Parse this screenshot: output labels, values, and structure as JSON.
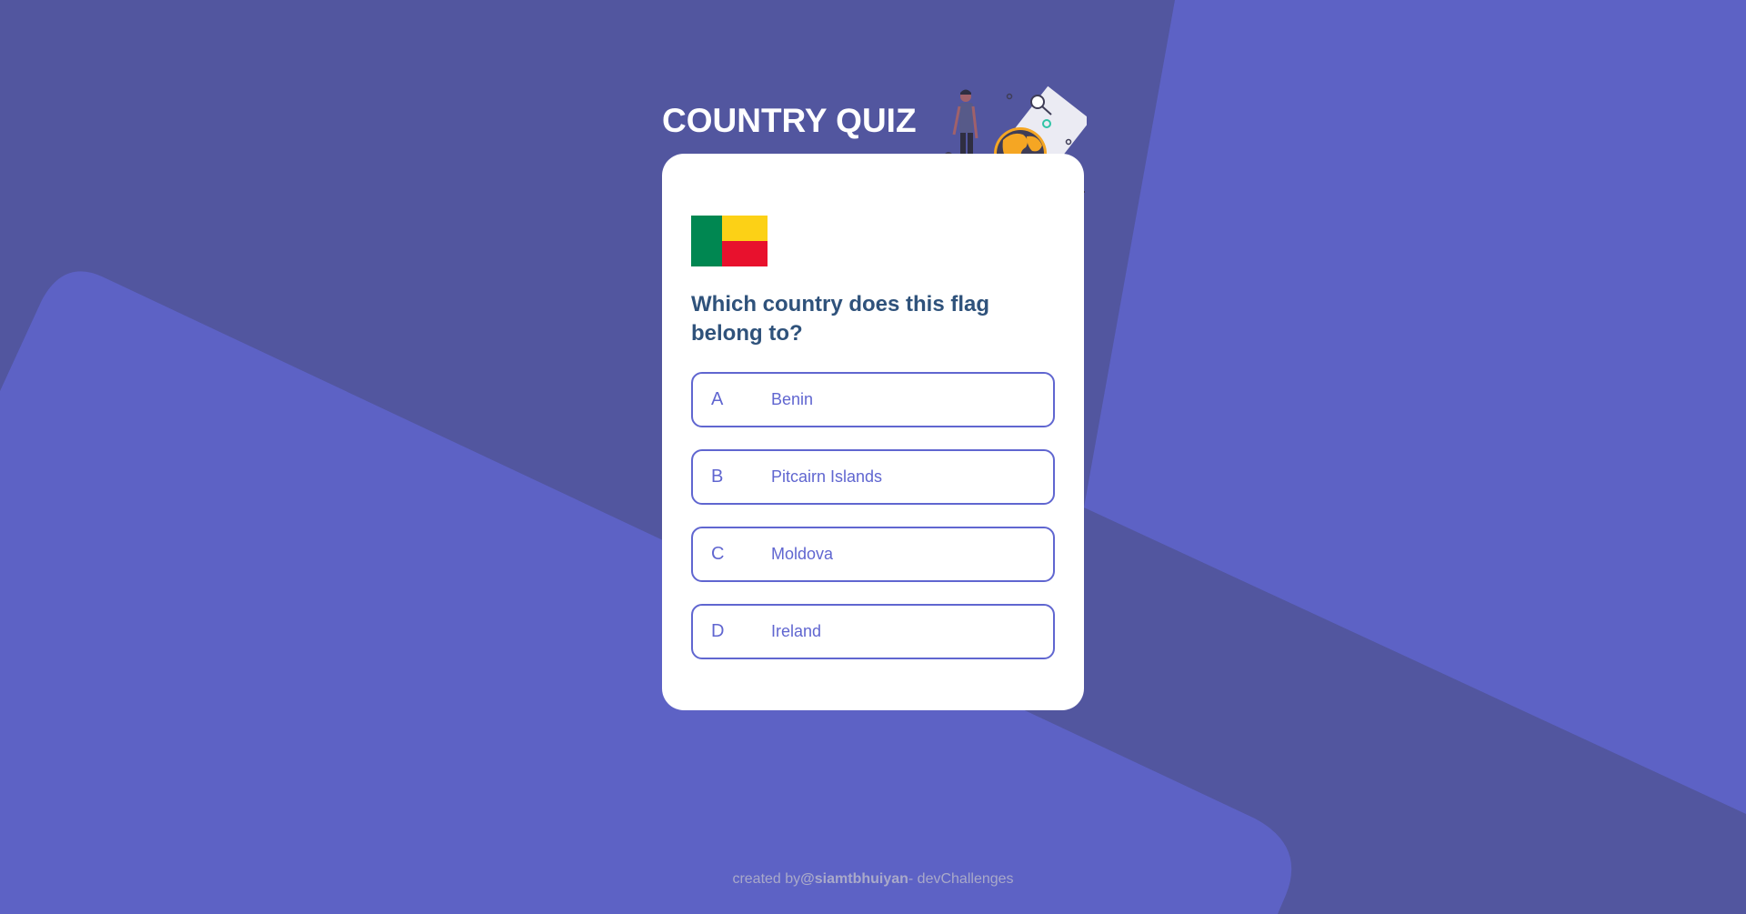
{
  "page": {
    "title": "COUNTRY QUIZ"
  },
  "colors": {
    "background": "#52569f",
    "background_shape": "#5d62c5",
    "card": "#ffffff",
    "question": "#2f527b",
    "option_accent": "#6066d0",
    "footer_text": "#a9a9c9"
  },
  "illustration": {
    "icon": "traveler-with-globe-icon"
  },
  "quiz": {
    "flag_icon": "benin-flag-icon",
    "flag_colors": [
      "#008751",
      "#fcd116",
      "#e8112d"
    ],
    "question": "Which country does this flag belong to?",
    "options": [
      {
        "letter": "A",
        "text": "Benin"
      },
      {
        "letter": "B",
        "text": "Pitcairn Islands"
      },
      {
        "letter": "C",
        "text": "Moldova"
      },
      {
        "letter": "D",
        "text": "Ireland"
      }
    ]
  },
  "footer": {
    "prefix": "created by",
    "handle": "@siamtbhuiyan",
    "suffix": "- devChallenges"
  }
}
